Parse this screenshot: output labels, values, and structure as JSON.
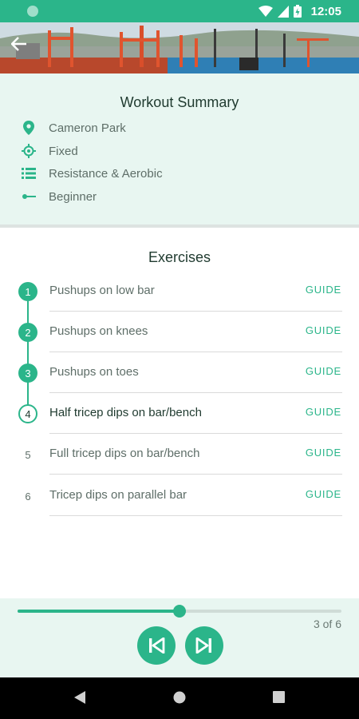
{
  "status_bar": {
    "time": "12:05"
  },
  "summary": {
    "title": "Workout Summary",
    "items": [
      {
        "icon": "location-pin-icon",
        "label": "Cameron Park"
      },
      {
        "icon": "target-icon",
        "label": "Fixed"
      },
      {
        "icon": "list-icon",
        "label": "Resistance & Aerobic"
      },
      {
        "icon": "level-icon",
        "label": "Beginner"
      }
    ]
  },
  "exercises": {
    "title": "Exercises",
    "guide_label": "GUIDE",
    "items": [
      {
        "number": "1",
        "name": "Pushups on low bar",
        "state": "done"
      },
      {
        "number": "2",
        "name": "Pushups on knees",
        "state": "done"
      },
      {
        "number": "3",
        "name": "Pushups on toes",
        "state": "done"
      },
      {
        "number": "4",
        "name": "Half tricep dips on bar/bench",
        "state": "current"
      },
      {
        "number": "5",
        "name": "Full tricep dips on bar/bench",
        "state": "todo"
      },
      {
        "number": "6",
        "name": "Tricep dips on parallel bar",
        "state": "todo"
      }
    ]
  },
  "player": {
    "progress_fraction": 0.5,
    "count_text": "3 of 6"
  },
  "colors": {
    "accent": "#2bb58a",
    "summary_background": "#e8f6f1",
    "heading_text": "#1f3a2f",
    "body_text": "#5e6e68"
  }
}
